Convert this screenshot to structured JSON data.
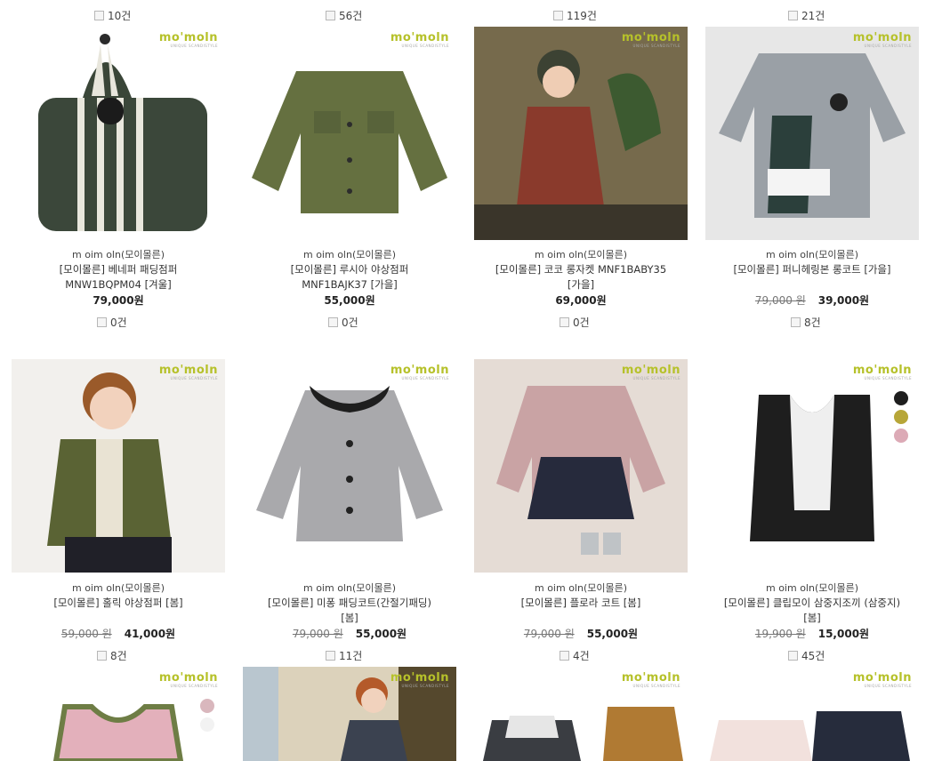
{
  "brand_logo": {
    "mark": "mo'moln",
    "tagline": "UNIQUE SCANDISTYLE"
  },
  "top_counts": [
    "10건",
    "56건",
    "119건",
    "21건"
  ],
  "rows": [
    {
      "products": [
        {
          "brand": "m oim oln(모이몰른)",
          "name_line1": "[모이몰른] 베네퍼 패딩점퍼",
          "name_line2": "MNW1BQPM04 [겨울]",
          "original_price": "",
          "price": "79,000원",
          "review_count": "0건",
          "swatches": []
        },
        {
          "brand": "m oim oln(모이몰른)",
          "name_line1": "[모이몰른] 루시아 야상점퍼",
          "name_line2": "MNF1BAJK37 [가을]",
          "original_price": "",
          "price": "55,000원",
          "review_count": "0건",
          "swatches": []
        },
        {
          "brand": "m oim oln(모이몰른)",
          "name_line1": "[모이몰른] 코코 롱자켓 MNF1BABY35",
          "name_line2": "[가을]",
          "original_price": "",
          "price": "69,000원",
          "review_count": "0건",
          "swatches": []
        },
        {
          "brand": "m oim oln(모이몰른)",
          "name_line1": "[모이몰른] 퍼니헤링본 롱코트 [가을]",
          "name_line2": "",
          "original_price": "79,000 원",
          "price": "39,000원",
          "review_count": "8건",
          "swatches": []
        }
      ]
    },
    {
      "products": [
        {
          "brand": "m oim oln(모이몰른)",
          "name_line1": "[모이몰른] 홀릭 야상점퍼 [봄]",
          "name_line2": "",
          "original_price": "59,000 원",
          "price": "41,000원",
          "review_count": "8건",
          "swatches": []
        },
        {
          "brand": "m oim oln(모이몰른)",
          "name_line1": "[모이몰른] 미퐁 패딩코트(간절기패딩)",
          "name_line2": "[봄]",
          "original_price": "79,000 원",
          "price": "55,000원",
          "review_count": "11건",
          "swatches": []
        },
        {
          "brand": "m oim oln(모이몰른)",
          "name_line1": "[모이몰른] 플로라 코트 [봄]",
          "name_line2": "",
          "original_price": "79,000 원",
          "price": "55,000원",
          "review_count": "4건",
          "swatches": []
        },
        {
          "brand": "m oim oln(모이몰른)",
          "name_line1": "[모이몰른] 클립모이 삼중지조끼 (삼중지)",
          "name_line2": "[봄]",
          "original_price": "19,900 원",
          "price": "15,000원",
          "review_count": "45건",
          "swatches": [
            "#1e1e1e",
            "#b7a638",
            "#dcaab6"
          ]
        }
      ]
    }
  ],
  "third_row_swatches": [
    "#d9b7bd",
    "#f2f2f2"
  ],
  "colors": {
    "logo_green": "#b6c12a"
  }
}
